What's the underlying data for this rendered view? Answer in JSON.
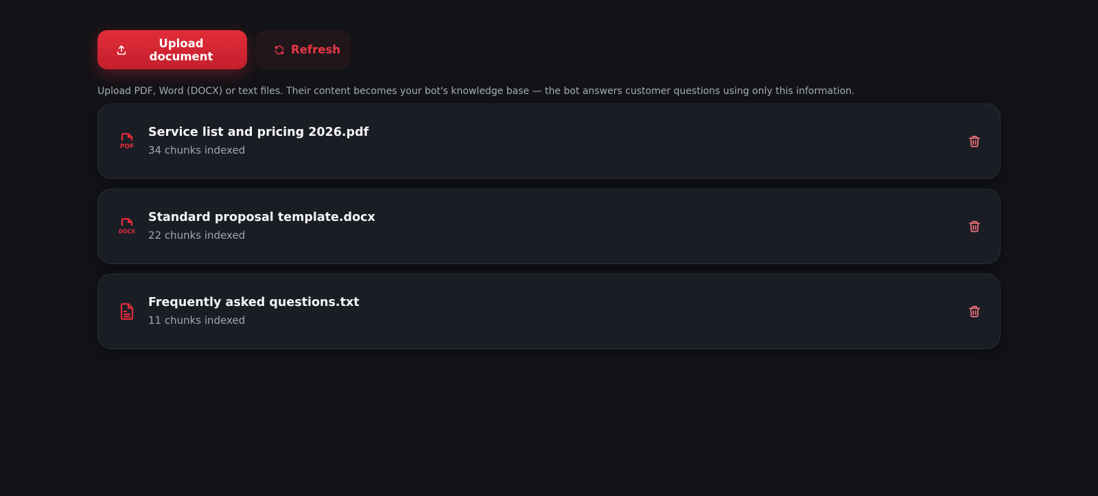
{
  "toolbar": {
    "upload_label": "Upload document",
    "refresh_label": "Refresh",
    "upload_icon": "upload-icon",
    "refresh_icon": "refresh-icon"
  },
  "hint": "Upload PDF, Word (DOCX) or text files. Their content becomes your bot's knowledge base — the bot answers customer questions using only this information.",
  "documents": [
    {
      "name": "Service list and pricing 2026.pdf",
      "meta": "34 chunks indexed",
      "type": "PDF",
      "icon": "pdf-file-icon"
    },
    {
      "name": "Standard proposal template.docx",
      "meta": "22 chunks indexed",
      "type": "DOCX",
      "icon": "docx-file-icon"
    },
    {
      "name": "Frequently asked questions.txt",
      "meta": "11 chunks indexed",
      "type": "TXT",
      "icon": "text-file-icon"
    }
  ],
  "colors": {
    "background": "#121317",
    "card": "#1b1d25",
    "accent": "#e22d3a",
    "muted_text": "#a7abb6",
    "delete_icon": "#f0737c"
  }
}
